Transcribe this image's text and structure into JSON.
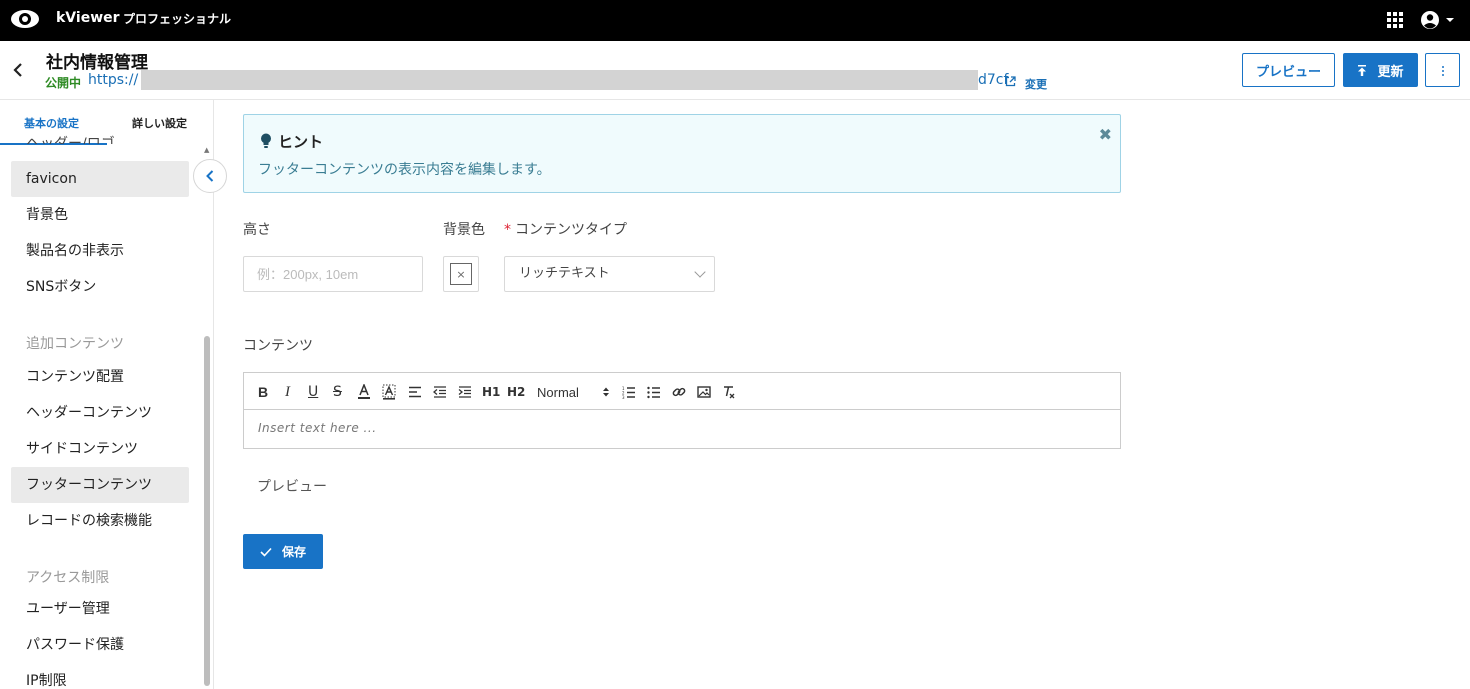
{
  "app": {
    "brand": "kViewer",
    "edition": "プロフェッショナル",
    "icons": {
      "logo": "eye-icon",
      "apps": "apps-grid-icon",
      "account": "account-circle-icon"
    }
  },
  "header": {
    "title": "社内情報管理",
    "status": "公開中",
    "url_prefix": "https://",
    "url_suffix": "d7cf",
    "change_label": "変更",
    "preview_button": "プレビュー",
    "update_button": "更新"
  },
  "sidebar": {
    "tabs": [
      "基本の設定",
      "詳しい設定"
    ],
    "partial_item": "ヘッダー/ロゴ",
    "items_top": [
      "favicon",
      "背景色",
      "製品名の非表示",
      "SNSボタン"
    ],
    "section_additional": "追加コンテンツ",
    "items_additional": [
      "コンテンツ配置",
      "ヘッダーコンテンツ",
      "サイドコンテンツ",
      "フッターコンテンツ",
      "レコードの検索機能"
    ],
    "section_access": "アクセス制限",
    "items_access": [
      "ユーザー管理",
      "パスワード保護",
      "IP制限"
    ]
  },
  "hint": {
    "title": "ヒント",
    "text": "フッターコンテンツの表示内容を編集します。",
    "close": "✖"
  },
  "form": {
    "height_label": "高さ",
    "height_placeholder": "例：200px, 10em",
    "bgcolor_label": "背景色",
    "bgcolor_clear": "×",
    "content_type_required": "*",
    "content_type_label": "コンテンツタイプ",
    "content_type_value": "リッチテキスト",
    "content_label": "コンテンツ",
    "editor": {
      "header_format": "Normal",
      "placeholder": "Insert text here ...",
      "h1": "H1",
      "h2": "H2"
    },
    "preview_label": "プレビュー",
    "save_button": "保存"
  },
  "colors": {
    "accent": "#1873c6",
    "status_green": "#2e8b24",
    "hint_bg": "#f0fbfd",
    "hint_border": "#9fd3e6"
  }
}
